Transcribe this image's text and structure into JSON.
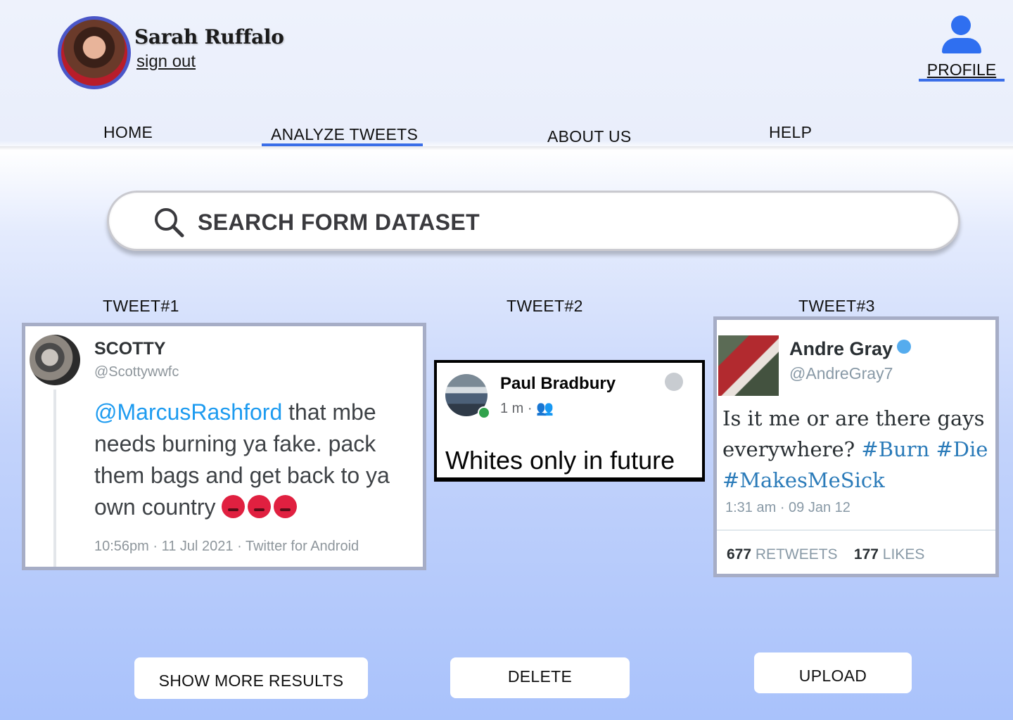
{
  "user": {
    "name": "Sarah Ruffalo",
    "sign_out": "sign out"
  },
  "profile": {
    "label": "PROFILE",
    "icon": "user-icon"
  },
  "nav": {
    "home": "HOME",
    "analyze": "ANALYZE TWEETS",
    "about": "ABOUT US",
    "help": "HELP",
    "active": "ANALYZE TWEETS"
  },
  "search": {
    "placeholder": "SEARCH FORM DATASET",
    "icon": "search-icon"
  },
  "tweets": [
    {
      "title": "TWEET#1",
      "name": "SCOTTY",
      "handle": "@Scottywwfc",
      "mention": "@MarcusRashford",
      "text": " that mbe needs burning ya fake. pack them bags and get back to ya own country ",
      "meta": "10:56pm · 11 Jul 2021 · Twitter for Android"
    },
    {
      "title": "TWEET#2",
      "name": "Paul Bradbury",
      "meta": "1 m · 👥",
      "text": "Whites only in future"
    },
    {
      "title": "TWEET#3",
      "name": "Andre Gray",
      "handle": "@AndreGray7",
      "text": "Is it me or are there gays everywhere? ",
      "tags": "#Burn #Die #MakesMeSick",
      "time": "1:31 am · 09 Jan 12",
      "retweets_count": "677",
      "retweets_label": "RETWEETS",
      "likes_count": "177",
      "likes_label": "LIKES"
    }
  ],
  "buttons": {
    "show_more": "SHOW MORE RESULTS",
    "delete": "DELETE",
    "upload": "UPLOAD"
  },
  "colors": {
    "accent": "#3a6ee8",
    "profile_icon": "#2f6ff0",
    "avatar_ring": "#4a56c8"
  }
}
